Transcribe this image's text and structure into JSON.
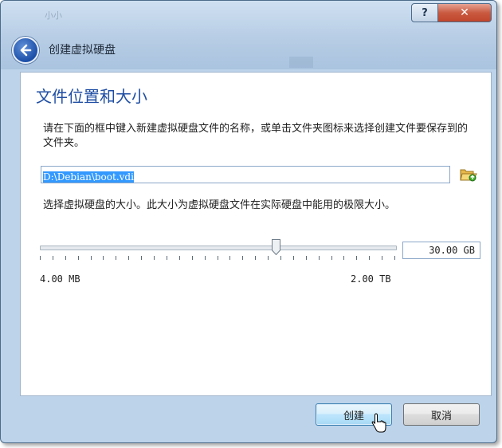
{
  "window": {
    "title": "创建虚拟硬盘",
    "ghost_title": "小小",
    "help_label": "?",
    "close_label": "✕"
  },
  "page": {
    "heading": "文件位置和大小",
    "location_text": "请在下面的框中键入新建虚拟硬盘文件的名称，或单击文件夹图标来选择创建文件要保存到的文件夹。",
    "file_path": "D:\\Debian\\boot.vdi",
    "size_text": "选择虚拟硬盘的大小。此大小为虚拟硬盘文件在实际硬盘中能用的极限大小。",
    "size_value": "30.00 GB",
    "min_label": "4.00 MB",
    "max_label": "2.00 TB",
    "slider_fraction": 0.67
  },
  "buttons": {
    "create": "创建",
    "cancel": "取消"
  },
  "icons": {
    "back": "back-arrow-icon",
    "folder": "folder-open-icon",
    "cursor": "mouse-cursor-icon"
  },
  "colors": {
    "heading": "#1f4ea3",
    "selection": "#3399ff",
    "window_frame": "#bcd3ea",
    "close": "#c95a40"
  }
}
